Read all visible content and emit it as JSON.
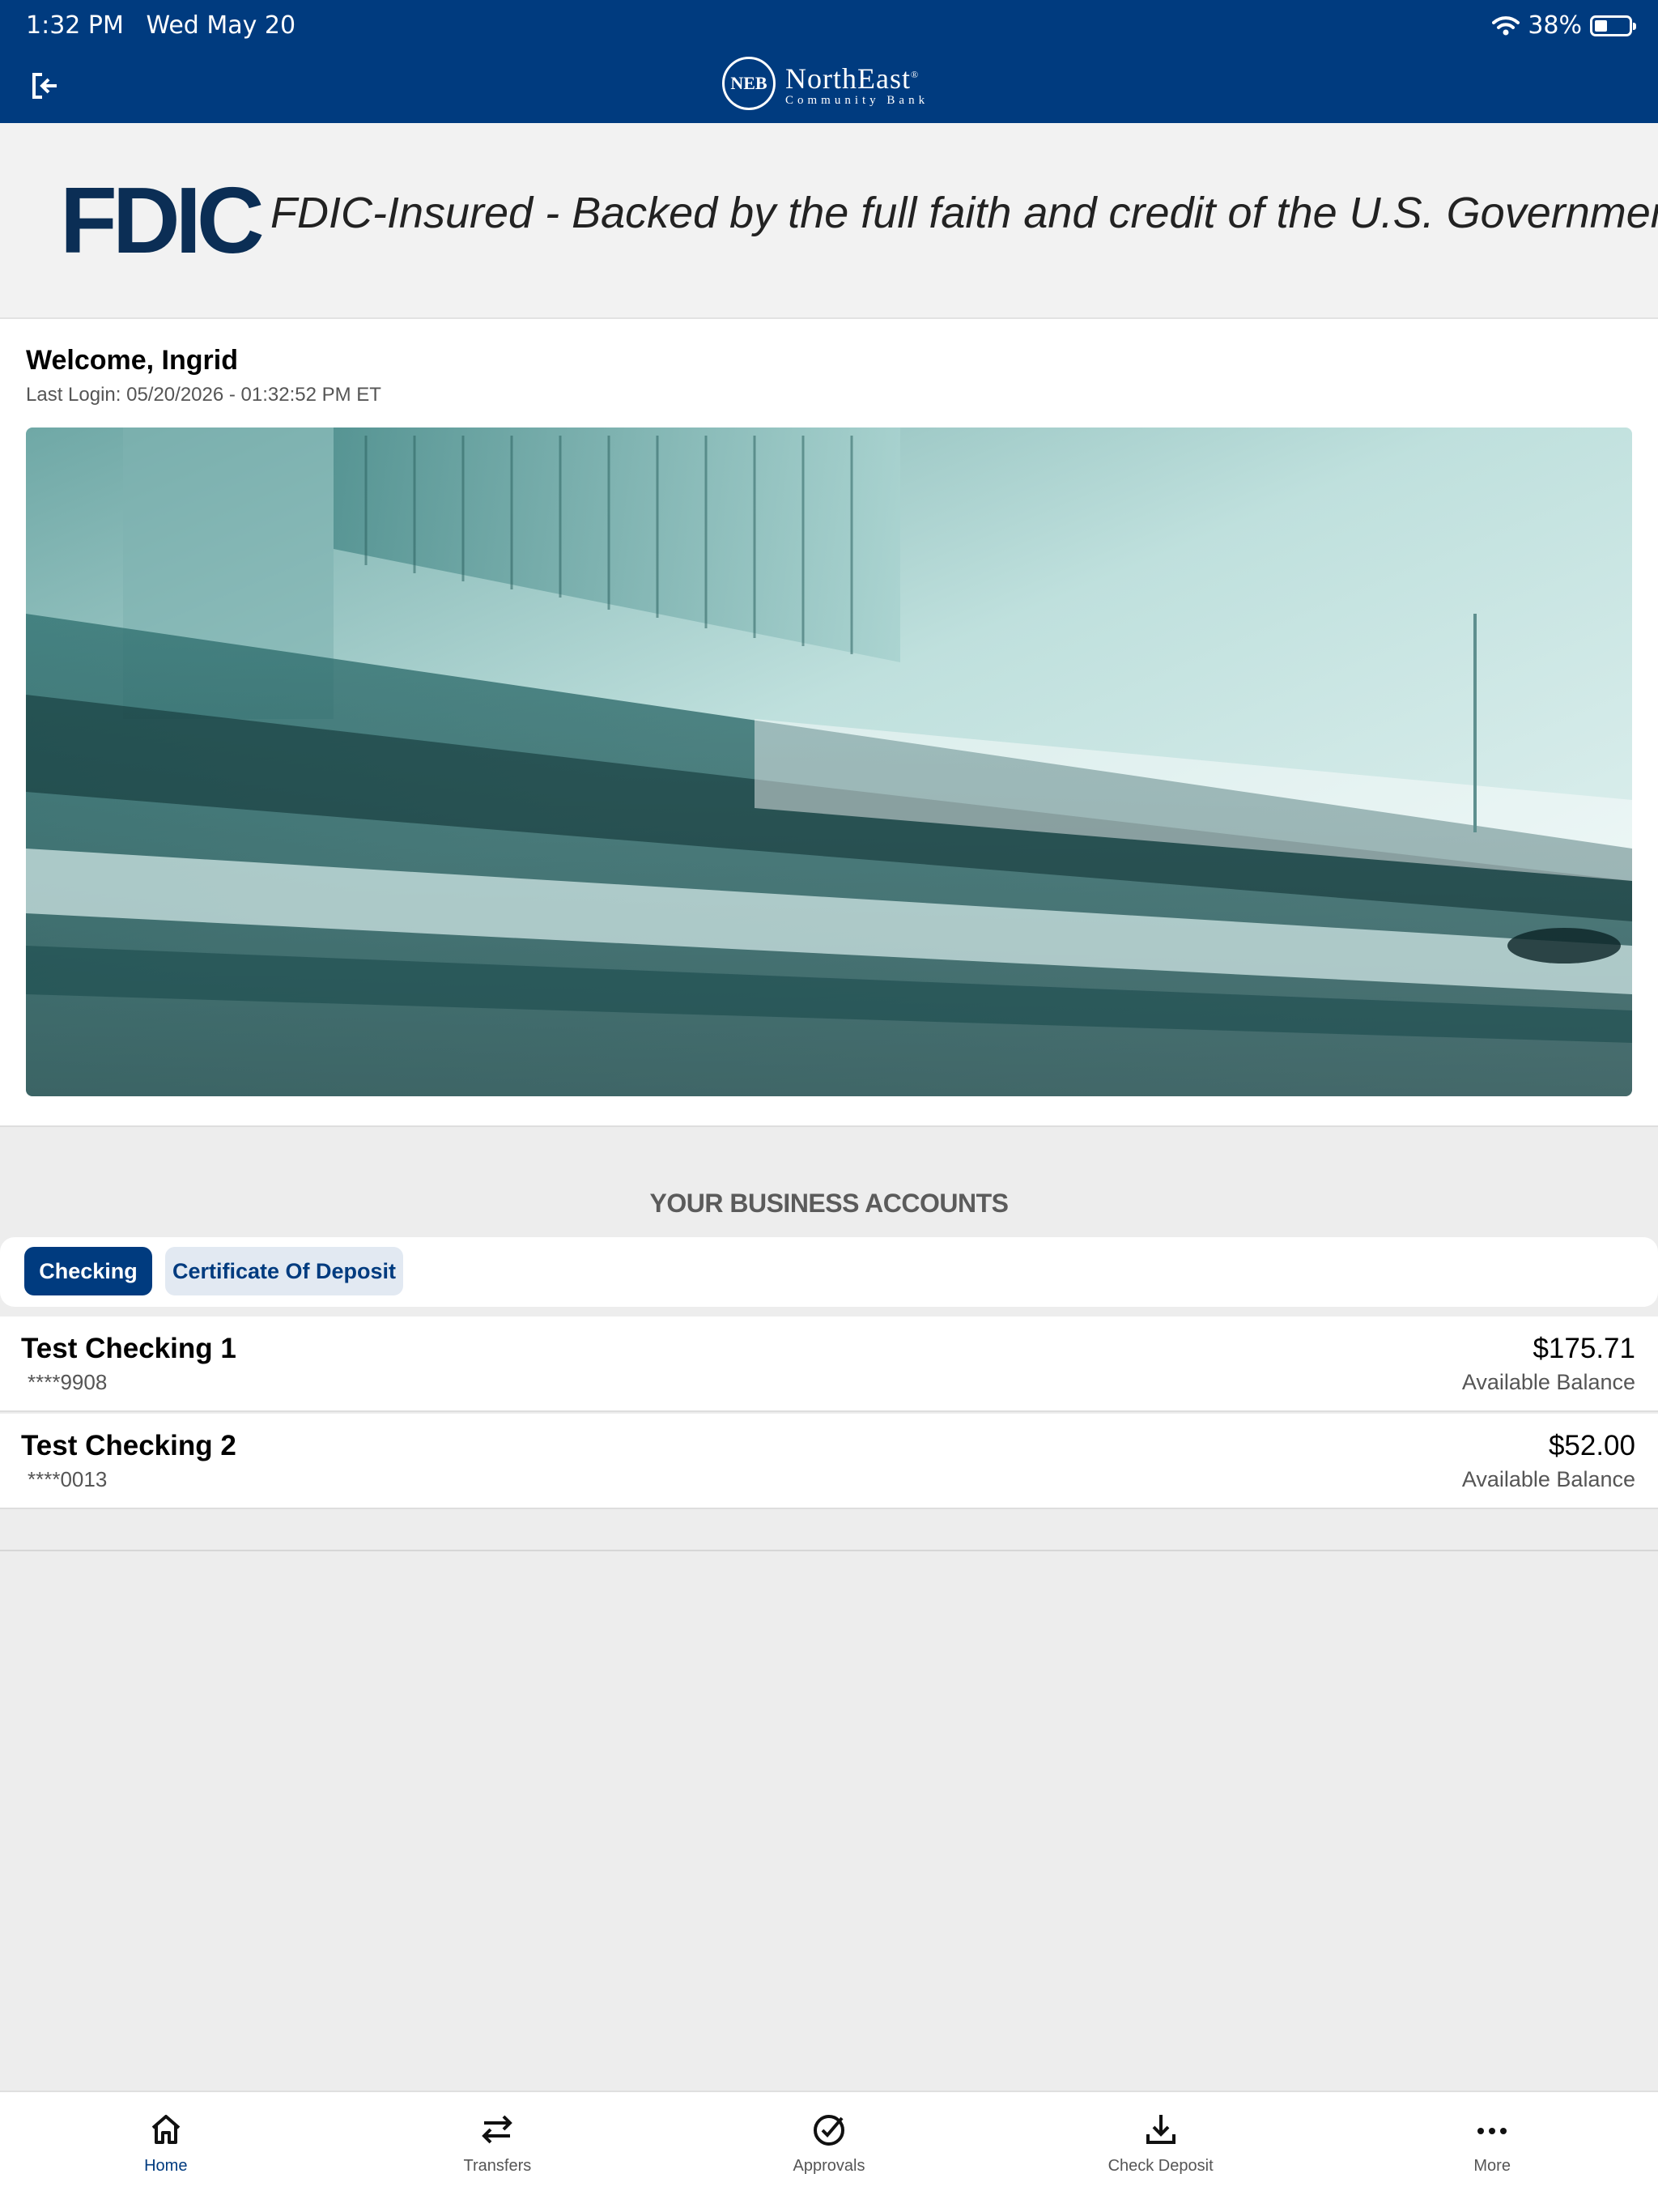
{
  "status_bar": {
    "time": "1:32 PM",
    "date": "Wed May 20",
    "battery": "38%"
  },
  "header": {
    "brand_name": "NorthEast",
    "brand_sub": "Community Bank",
    "seal_text": "NEB"
  },
  "fdic": {
    "logo": "FDIC",
    "text": "FDIC-Insured - Backed by the full faith and credit of the U.S. Government"
  },
  "welcome": {
    "title": "Welcome, Ingrid",
    "last_login": "Last Login: 05/20/2026 - 01:32:52 PM ET"
  },
  "accounts": {
    "title": "YOUR BUSINESS ACCOUNTS",
    "tabs": [
      "Checking",
      "Certificate Of Deposit"
    ],
    "items": [
      {
        "name": "Test Checking 1",
        "number": "****9908",
        "balance": "$175.71",
        "balance_label": "Available Balance"
      },
      {
        "name": "Test Checking 2",
        "number": "****0013",
        "balance": "$52.00",
        "balance_label": "Available Balance"
      }
    ]
  },
  "nav": [
    {
      "label": "Home",
      "icon": "home-icon",
      "active": true
    },
    {
      "label": "Transfers",
      "icon": "transfer-icon",
      "active": false
    },
    {
      "label": "Approvals",
      "icon": "check-circle-icon",
      "active": false
    },
    {
      "label": "Check Deposit",
      "icon": "download-icon",
      "active": false
    },
    {
      "label": "More",
      "icon": "more-icon",
      "active": false
    }
  ],
  "colors": {
    "brand": "#003b7f",
    "fdic_navy": "#0b2e55",
    "background": "#ededed"
  }
}
